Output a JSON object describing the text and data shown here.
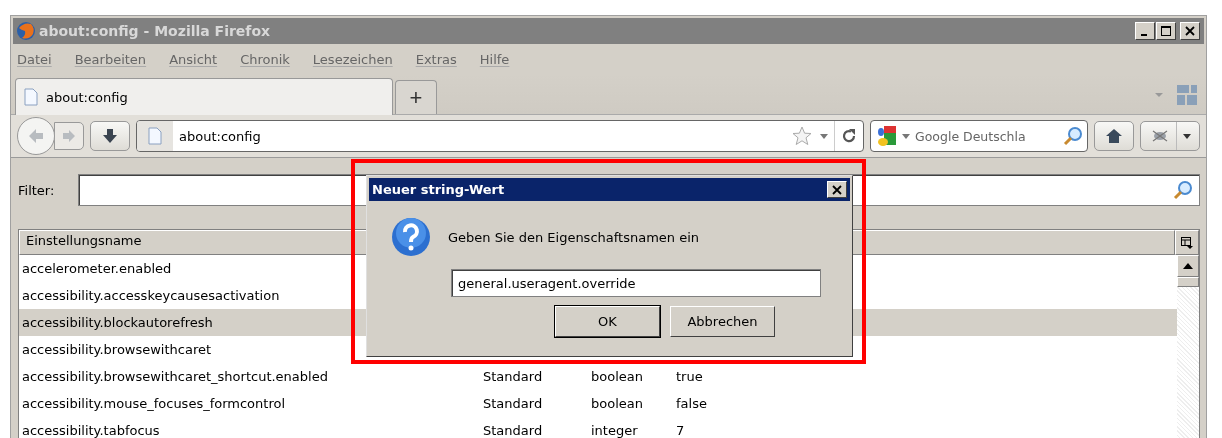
{
  "window": {
    "title": "about:config - Mozilla Firefox"
  },
  "menu": [
    {
      "label": "Datei"
    },
    {
      "label": "Bearbeiten"
    },
    {
      "label": "Ansicht"
    },
    {
      "label": "Chronik"
    },
    {
      "label": "Lesezeichen"
    },
    {
      "label": "Extras"
    },
    {
      "label": "Hilfe"
    }
  ],
  "tabs": [
    {
      "label": "about:config",
      "selected": true
    }
  ],
  "new_tab": "+",
  "address_bar": {
    "value": "about:config"
  },
  "search": {
    "placeholder": "Google Deutschla"
  },
  "filter": {
    "label": "Filter:"
  },
  "table": {
    "columns": [
      "Einstellungsname"
    ],
    "rows": [
      {
        "name": "accelerometer.enabled",
        "selected": false
      },
      {
        "name": "accessibility.accesskeycausesactivation",
        "selected": false
      },
      {
        "name": "accessibility.blockautorefresh",
        "selected": true
      },
      {
        "name": "accessibility.browsewithcaret",
        "selected": false
      },
      {
        "name": "accessibility.browsewithcaret_shortcut.enabled",
        "status": "Standard",
        "type": "boolean",
        "value": "true",
        "selected": false
      },
      {
        "name": "accessibility.mouse_focuses_formcontrol",
        "status": "Standard",
        "type": "boolean",
        "value": "false",
        "selected": false
      },
      {
        "name": "accessibility.tabfocus",
        "status": "Standard",
        "type": "integer",
        "value": "7",
        "selected": false
      }
    ]
  },
  "dialog": {
    "title": "Neuer string-Wert",
    "message": "Geben Sie den Eigenschaftsnamen ein",
    "value": "general.useragent.override",
    "buttons": [
      "OK",
      "Abbrechen"
    ],
    "highlighted": true
  }
}
